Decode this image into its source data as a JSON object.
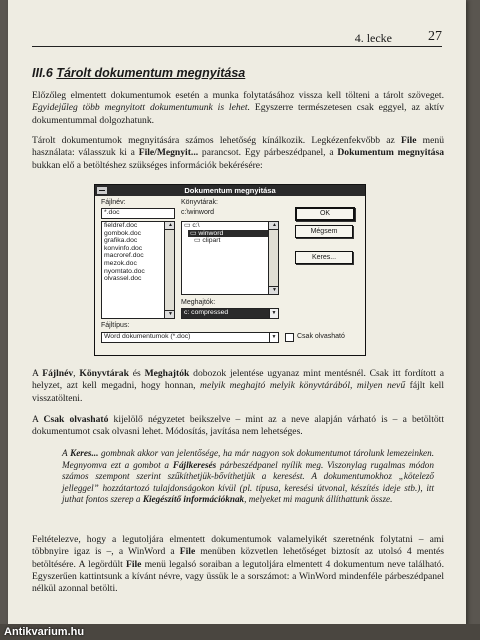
{
  "header": {
    "lesson": "4. lecke",
    "page_number": "27"
  },
  "section": {
    "number": "III.6",
    "title": "Tárolt dokumentum megnyitása"
  },
  "p1": {
    "a": "Előzőleg elmentett dokumentumok esetén a munka folytatásához vissza kell tölteni a tárolt szöveget. ",
    "b": "Egyidejűleg több megnyitott dokumentumunk is lehet.",
    "c": " Egyszerre természetesen csak eggyel, az aktív dokumentummal dolgozhatunk."
  },
  "p2": {
    "a": "Tárolt dokumentumok megnyitására számos lehetőség kínálkozik. Legkézenfekvőbb az ",
    "b": "File",
    "c": " menü használata: válasszuk ki a ",
    "d": "File/Megnyit...",
    "e": " parancsot. Egy párbeszédpanel, a ",
    "f": "Dokumentum megnyitása",
    "g": " bukkan elő a betöltéshez szükséges információk bekérésére:"
  },
  "dialog": {
    "title": "Dokumentum megnyitása",
    "filename_label": "Fájlnév:",
    "filename_value": "*.doc",
    "files": [
      "fieldref.doc",
      "gombok.doc",
      "grafika.doc",
      "konvinfo.doc",
      "macroref.doc",
      "mezok.doc",
      "nyomtato.doc",
      "olvassel.doc"
    ],
    "dirs_label": "Könyvtárak:",
    "dirs_path": "c:\\winword",
    "dirs": [
      "c:\\",
      "winword",
      "clipart"
    ],
    "drives_label": "Meghajtók:",
    "drive_value": "c: compressed",
    "filetype_label": "Fájltípus:",
    "filetype_value": "Word dokumentumok (*.doc)",
    "ok": "OK",
    "cancel": "Mégsem",
    "search": "Keres...",
    "readonly": "Csak olvasható"
  },
  "p3": {
    "a": "A ",
    "b": "Fájlnév",
    "c": ", ",
    "d": "Könyvtárak",
    "e": " és ",
    "f": "Meghajtók",
    "g": " dobozok jelentése ugyanaz mint mentésnél. Csak itt fordított a helyzet, azt kell megadni, hogy honnan, ",
    "h": "melyik meghajtó melyik könyvtárából, milyen nevű",
    "i": " fájlt kell visszatölteni."
  },
  "p4": {
    "a": "A ",
    "b": "Csak olvasható",
    "c": " kijelölő négyzetet beikszelve – mint az a neve alapján várható is – a betöltött dokumentumot csak olvasni lehet. Módosítás, javítása nem lehetséges."
  },
  "quote": {
    "a": "A ",
    "b": "Keres...",
    "c": " gombnak akkor van jelentősége, ha már nagyon sok dokumentumot tárolunk lemezeinken. Megnyomva ezt a gombot a ",
    "d": "Fájlkeresés",
    "e": " párbeszédpanel nyílik meg. Viszonylag rugalmas módon számos szempont szerint szűkíthetjük-bővíthetjük a keresést. A dokumentumokhoz „kötelező jelleggel” hozzátartozó tulajdonságokon kívül (pl. típusa, keresési útvonal, készítés ideje stb.), itt juthat fontos szerep a ",
    "f": "Kiegészítő információknak",
    "g": ", melyeket mi magunk állíthattunk össze."
  },
  "p5": {
    "a": "Feltételezve, hogy a legutoljára elmentett dokumentumok valamelyikét szeretnénk folytatni – ami többnyire igaz is –, a WinWord a ",
    "b": "File",
    "c": " menüben közvetlen lehetőséget biztosít az utolsó 4 mentés betöltésére. A legördült ",
    "d": "File",
    "e": " menü legalsó soraiban a legutoljára elmentett 4 dokumentum neve található. Egyszerűen kattintsunk a kívánt névre, vagy üssük le a sorszámot: a WinWord mindenféle párbeszédpanel nélkül azonnal betölti."
  },
  "watermark": "Antikvarium.hu"
}
